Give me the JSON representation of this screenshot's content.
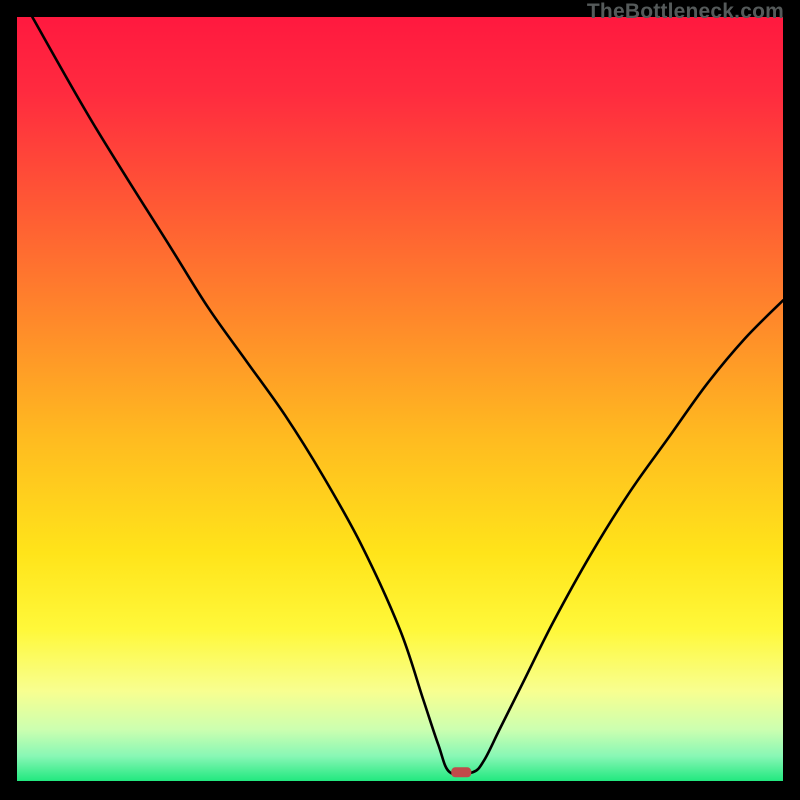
{
  "watermark": "TheBottleneck.com",
  "chart_data": {
    "type": "line",
    "title": "",
    "xlabel": "",
    "ylabel": "",
    "xlim": [
      0,
      100
    ],
    "ylim": [
      0,
      100
    ],
    "grid": false,
    "series": [
      {
        "name": "curve",
        "x": [
          2,
          10,
          20,
          25,
          30,
          35,
          40,
          45,
          50,
          53,
          55,
          56.5,
          59.5,
          61,
          63,
          66,
          70,
          75,
          80,
          85,
          90,
          95,
          100
        ],
        "values": [
          100,
          86,
          70,
          62,
          55,
          48,
          40,
          31,
          20,
          11,
          5,
          1.4,
          1.4,
          3,
          7,
          13,
          21,
          30,
          38,
          45,
          52,
          58,
          63
        ]
      }
    ],
    "marker": {
      "x": 58,
      "y": 1.4,
      "color": "#c04a4a"
    },
    "gradient_stops": [
      {
        "offset": 0.0,
        "color": "#ff193f"
      },
      {
        "offset": 0.1,
        "color": "#ff2b3f"
      },
      {
        "offset": 0.25,
        "color": "#ff5a34"
      },
      {
        "offset": 0.4,
        "color": "#ff8a2a"
      },
      {
        "offset": 0.55,
        "color": "#ffbb20"
      },
      {
        "offset": 0.7,
        "color": "#ffe41a"
      },
      {
        "offset": 0.8,
        "color": "#fff83a"
      },
      {
        "offset": 0.88,
        "color": "#f8ff90"
      },
      {
        "offset": 0.93,
        "color": "#ccffb0"
      },
      {
        "offset": 0.965,
        "color": "#88f7b5"
      },
      {
        "offset": 1.0,
        "color": "#19e77b"
      }
    ]
  }
}
